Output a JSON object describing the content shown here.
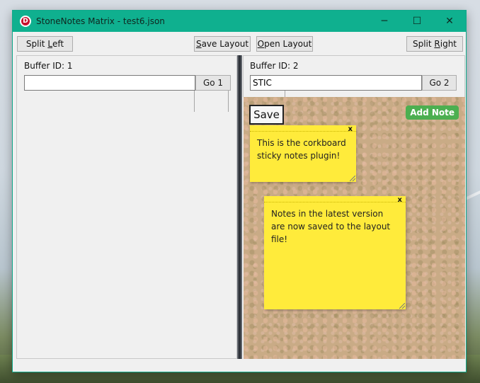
{
  "window": {
    "title": "StoneNotes Matrix - test6.json",
    "app_icon_letter": "D",
    "minimize_glyph": "─",
    "maximize_glyph": "☐",
    "close_glyph": "✕",
    "accent_color": "#0fb08f"
  },
  "toolbar": {
    "split_left": {
      "pre": "Split ",
      "key": "L",
      "post": "eft"
    },
    "save_layout": {
      "pre": "",
      "key": "S",
      "post": "ave Layout"
    },
    "open_layout": {
      "pre": "",
      "key": "O",
      "post": "pen Layout"
    },
    "split_right": {
      "pre": "Split ",
      "key": "R",
      "post": "ight"
    }
  },
  "left_pane": {
    "buffer_label": "Buffer ID: 1",
    "input_value": "",
    "go_label": "Go 1"
  },
  "right_pane": {
    "buffer_label": "Buffer ID: 2",
    "input_value": "STIC",
    "go_label": "Go 2",
    "corkboard": {
      "save_label": "Save",
      "add_note_label": "Add Note",
      "add_note_color": "#4caf50",
      "note_color": "#ffeb3b",
      "notes": [
        {
          "text": "This is the corkboard sticky notes plugin!",
          "close": "x"
        },
        {
          "text": "Notes in the latest version are now saved to the layout file!",
          "close": "x"
        }
      ]
    }
  }
}
